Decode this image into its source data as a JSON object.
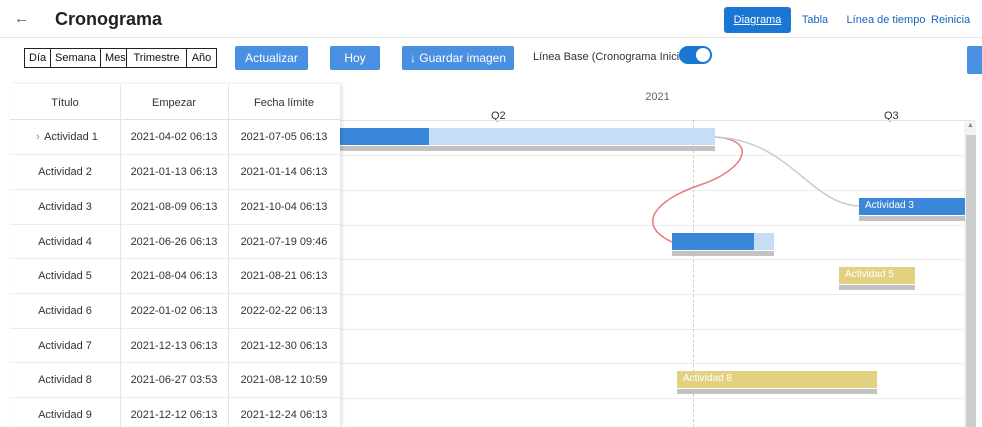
{
  "header": {
    "back_icon": "arrow-left-icon",
    "title": "Cronograma",
    "nav": [
      "Diagrama",
      "Tabla",
      "Línea de tiempo",
      "Reinicia"
    ],
    "active_nav": "Diagrama"
  },
  "toolbar": {
    "scale_buttons": [
      "Día",
      "Semana",
      "Mes",
      "Trimestre",
      "Año"
    ],
    "update_label": "Actualizar",
    "today_label": "Hoy",
    "save_image_label": "↓ Guardar imagen",
    "baseline_label": "Línea Base (Cronograma Inicial):",
    "baseline_on": true
  },
  "grid": {
    "columns": [
      "Título",
      "Empezar",
      "Fecha límite"
    ],
    "rows": [
      {
        "title": "Actividad 1",
        "start": "2021-04-02 06:13",
        "due": "2021-07-05 06:13",
        "expandable": true
      },
      {
        "title": "Actividad 2",
        "start": "2021-01-13 06:13",
        "due": "2021-01-14 06:13"
      },
      {
        "title": "Actividad 3",
        "start": "2021-08-09 06:13",
        "due": "2021-10-04 06:13"
      },
      {
        "title": "Actividad 4",
        "start": "2021-06-26 06:13",
        "due": "2021-07-19 09:46"
      },
      {
        "title": "Actividad 5",
        "start": "2021-08-04 06:13",
        "due": "2021-08-21 06:13"
      },
      {
        "title": "Actividad 6",
        "start": "2022-01-02 06:13",
        "due": "2022-02-22 06:13"
      },
      {
        "title": "Actividad 7",
        "start": "2021-12-13 06:13",
        "due": "2021-12-30 06:13"
      },
      {
        "title": "Actividad 8",
        "start": "2021-06-27 03:53",
        "due": "2021-08-12 10:59"
      },
      {
        "title": "Actividad 9",
        "start": "2021-12-12 06:13",
        "due": "2021-12-24 06:13"
      }
    ]
  },
  "timeline": {
    "year": "2021",
    "quarters": [
      "Q2",
      "Q3"
    ]
  },
  "bars": {
    "actividad3_label": "Actividad 3",
    "actividad5_label": "Actividad 5",
    "actividad8_label": "Actividad 8"
  },
  "colors": {
    "accent": "#1976d2",
    "progress": "#3a86d8",
    "remaining": "#c6def5",
    "milestone_gold": "#e3d181",
    "baseline": "#c2c2c2",
    "link_red": "#e87b7b",
    "link_gray": "#cccccc"
  }
}
